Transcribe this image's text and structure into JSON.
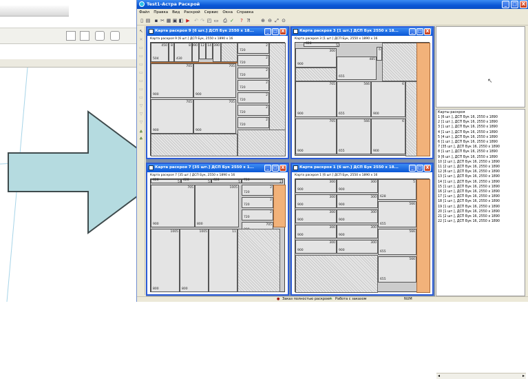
{
  "window": {
    "title": "Test1-Астра Раскрой",
    "min_label": "_",
    "max_label": "□",
    "close_label": "X"
  },
  "menu": [
    "Файл",
    "Правка",
    "Вид",
    "Раскрой",
    "Сервис",
    "Окна",
    "Справка"
  ],
  "children": [
    {
      "title": "Карта раскроя 9 [6 шт.] ДСП Бук 2550 x 18...",
      "subtitle": "Карта раскроя 9 [6 шт.] ДСП Бук, 2550 x 1890 x 16",
      "parts": [
        {
          "w": "504",
          "h": "450"
        },
        {
          "w": "",
          "h": "8"
        },
        {
          "w": "430",
          "h": "8"
        },
        {
          "w": "",
          "h": "390"
        },
        {
          "w": "",
          "h": "12"
        },
        {
          "w": "",
          "h": "14"
        },
        {
          "w": "",
          "h": "390"
        },
        {
          "w": "720",
          "h": "2"
        },
        {
          "w": "720",
          "h": "2"
        },
        {
          "w": "720",
          "h": "2"
        },
        {
          "w": "720",
          "h": "2"
        },
        {
          "w": "720",
          "h": "2"
        },
        {
          "w": "720",
          "h": "2"
        },
        {
          "w": "720",
          "h": "2"
        },
        {
          "w": "900",
          "h": "705"
        },
        {
          "w": "900",
          "h": "705"
        },
        {
          "w": "900",
          "h": "705"
        },
        {
          "w": "900",
          "h": "705"
        }
      ]
    },
    {
      "title": "Карта раскроя 3 [1 шт.] ДСП Бук 2550 x 18...",
      "subtitle": "Карта раскроя 3 [1 шт.] ДСП Бук, 2550 x 1890 x 16",
      "parts": [
        {
          "w": "628",
          "h": "5"
        },
        {
          "w": "900",
          "h": "300"
        },
        {
          "w": "655",
          "h": "485"
        },
        {
          "w": "",
          "h": "6"
        },
        {
          "w": "900",
          "h": "705"
        },
        {
          "w": "655",
          "h": "566"
        },
        {
          "w": "900",
          "h": "6"
        },
        {
          "w": "900",
          "h": "705"
        },
        {
          "w": "655",
          "h": "566"
        },
        {
          "w": "900",
          "h": "6"
        }
      ]
    },
    {
      "title": "Карта раскроя 7 [35 шт.] ДСП Бук 2550 x 1...",
      "subtitle": "Карта раскроя 7 [35 шт.] ДСП Бук, 2550 x 1890 x 16",
      "parts": [
        {
          "w": "628",
          "h": "5"
        },
        {
          "w": "628",
          "h": "5"
        },
        {
          "w": "628",
          "h": "5"
        },
        {
          "w": "720",
          "h": "2"
        },
        {
          "w": "720",
          "h": "2"
        },
        {
          "w": "720",
          "h": "2"
        },
        {
          "w": "720",
          "h": "2"
        },
        {
          "w": "900",
          "h": "705"
        },
        {
          "w": "900",
          "h": "705"
        },
        {
          "w": "800",
          "h": "1005"
        },
        {
          "w": "800",
          "h": "1005"
        },
        {
          "w": "800",
          "h": "1005"
        },
        {
          "w": "",
          "h": "11"
        }
      ]
    },
    {
      "title": "Карта раскроя 1 [6 шт.] ДСП Бук 2550 x 18...",
      "subtitle": "Карта раскроя 1 [6 шт.] ДСП Бук, 2550 x 1890 x 16",
      "parts": [
        {
          "w": "900",
          "h": "300"
        },
        {
          "w": "900",
          "h": "300"
        },
        {
          "w": "628",
          "h": "5"
        },
        {
          "w": "900",
          "h": "300"
        },
        {
          "w": "900",
          "h": "300"
        },
        {
          "w": "655",
          "h": "566"
        },
        {
          "w": "900",
          "h": "300"
        },
        {
          "w": "900",
          "h": "300"
        },
        {
          "w": "900",
          "h": "300"
        },
        {
          "w": "900",
          "h": "300"
        },
        {
          "w": "655",
          "h": "566"
        },
        {
          "w": "900",
          "h": "300"
        },
        {
          "w": "900",
          "h": "300"
        },
        {
          "w": "655",
          "h": "566"
        }
      ]
    }
  ],
  "list": {
    "header": "Карты раскроя",
    "items": [
      "1 [6 шт.], ДСП Бук 16, 2550 x 1890",
      "2 [1 шт.], ДСП Бук 16, 2550 x 1890",
      "3 [1 шт.], ДСП Бук 16, 2550 x 1890",
      "4 [1 шт.], ДСП Бук 16, 2550 x 1890",
      "5 [4 шт.], ДСП Бук 16, 2550 x 1890",
      "6 [1 шт.], ДСП Бук 16, 2550 x 1890",
      "7 [35 шт.], ДСП Бук 16, 2550 x 1890",
      "8 [1 шт.], ДСП Бук 16, 2550 x 1890",
      "9 [6 шт.], ДСП Бук 16, 2550 x 1890",
      "10 [2 шт.], ДСП Бук 16, 2550 x 1890",
      "11 [2 шт.], ДСП Бук 16, 2550 x 1890",
      "12 [6 шт.], ДСП Бук 16, 2550 x 1890",
      "13 [1 шт.], ДСП Бук 16, 2550 x 1890",
      "14 [1 шт.], ДСП Бук 16, 2550 x 1890",
      "15 [1 шт.], ДСП Бук 16, 2550 x 1890",
      "16 [2 шт.], ДСП Бук 16, 2550 x 1890",
      "17 [1 шт.], ДСП Бук 16, 2550 x 1890",
      "18 [1 шт.], ДСП Бук 16, 2550 x 1890",
      "19 [1 шт.], ДСП Бук 16, 2550 x 1890",
      "20 [1 шт.], ДСП Бук 16, 2550 x 1890",
      "21 [2 шт.], ДСП Бук 16, 2550 x 1890",
      "22 [1 шт.], ДСП Бук 16, 2550 x 1890"
    ]
  },
  "status": {
    "message": "Заказ полностью раскроен",
    "mode": "Работа с заказом",
    "num": "NUM"
  },
  "colors": {
    "title_blue": "#0a57d6",
    "arrow": "#b5dbe0",
    "waste": "#f2b27a"
  }
}
